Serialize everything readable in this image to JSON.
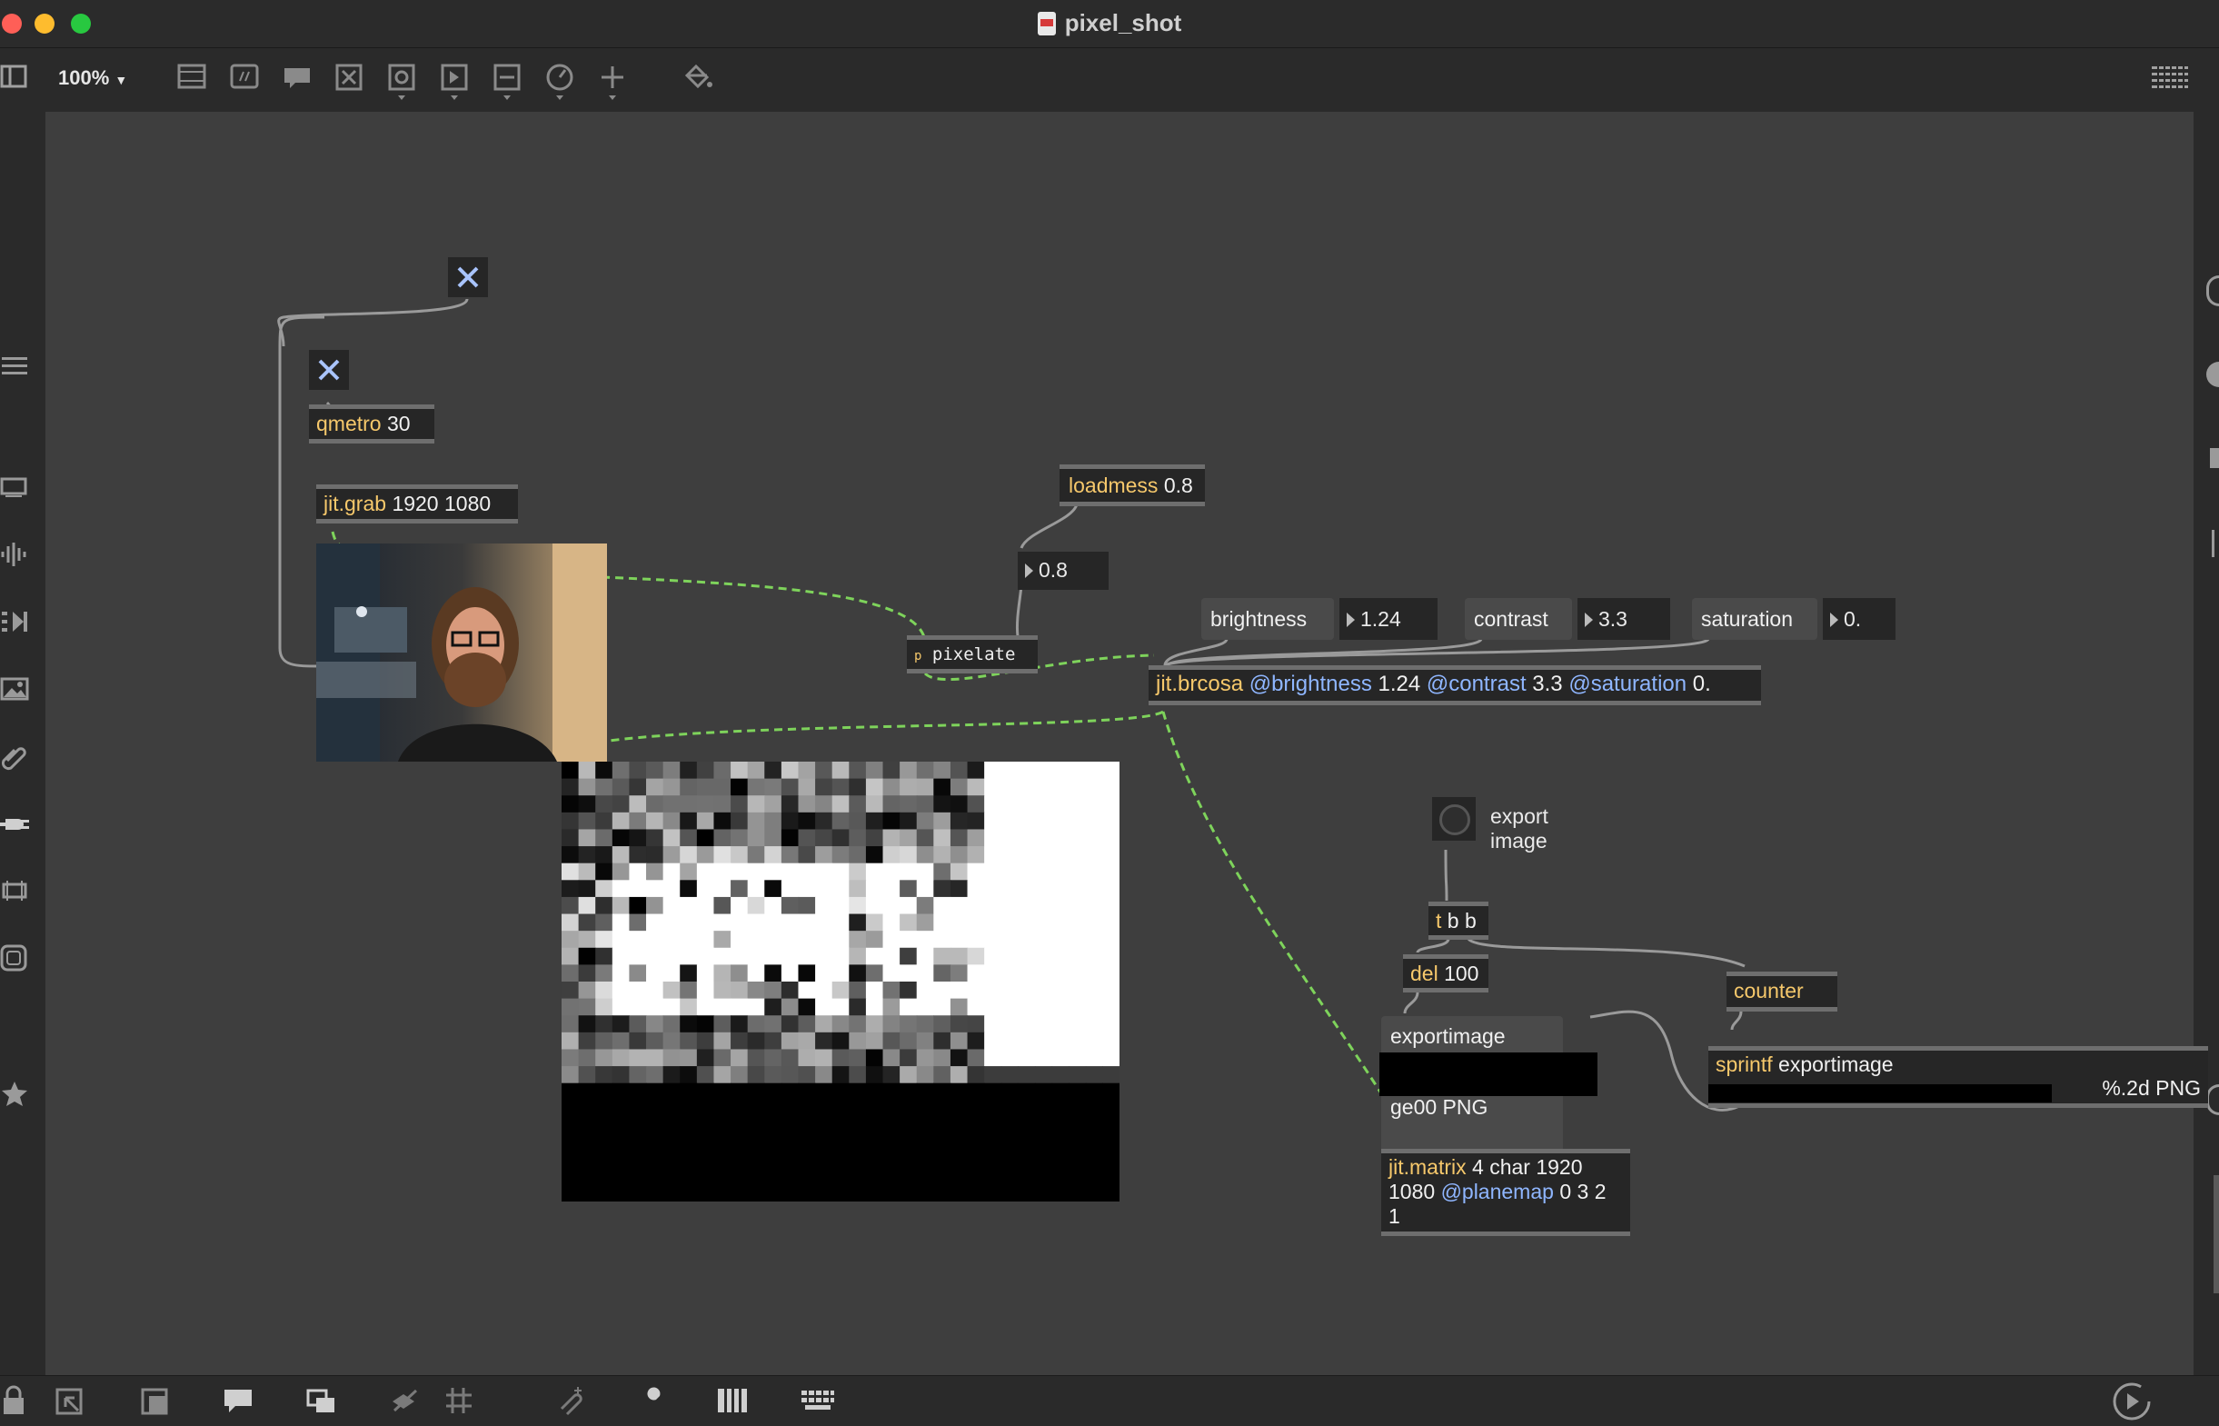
{
  "window": {
    "title": "pixel_shot"
  },
  "toolbar": {
    "zoom": "100%",
    "zoom_arrow": "▼"
  },
  "objects": {
    "qmetro": {
      "cls": "qmetro",
      "args": "30"
    },
    "jitgrab": {
      "cls": "jit.grab",
      "args": "1920 1080"
    },
    "loadmess": {
      "cls": "loadmess",
      "args": "0.8"
    },
    "num_pixel": "0.8",
    "pixelate": {
      "p": "p",
      "name": "pixelate"
    },
    "brightness_msg": "brightness",
    "brightness_val": "1.24",
    "contrast_msg": "contrast",
    "contrast_val": "3.3",
    "saturation_msg": "saturation",
    "saturation_val": "0.",
    "brcosa": {
      "cls": "jit.brcosa",
      "a1": "@brightness",
      "v1": "1.24",
      "a2": "@contrast",
      "v2": "3.3",
      "a3": "@saturation",
      "v3": "0."
    },
    "export_comment_1": "export",
    "export_comment_2": "image",
    "tbb": {
      "cls": "t",
      "args": "b b"
    },
    "del": {
      "cls": "del",
      "args": "100"
    },
    "counter": {
      "cls": "counter"
    },
    "exportimage_msg_top": "exportimage",
    "exportimage_msg_bottom": "ge00 PNG",
    "sprintf": {
      "cls": "sprintf",
      "line1": "exportimage",
      "line2_end": "%.2d PNG"
    },
    "jitmatrix": {
      "cls": "jit.matrix",
      "args1": "4 char 1920",
      "args2a": "1080",
      "attr": "@planemap",
      "args2b": "0 3 2",
      "args3": "1"
    }
  },
  "colors": {
    "canvas": "#3e3e3e",
    "object_bg": "#262626",
    "class_text": "#f6c86b",
    "attr_text": "#8fb6ff",
    "jitter_wire": "#7ed35b",
    "wire": "#9a9a9a",
    "toggle_x": "#a9c4ff"
  },
  "icons": {
    "left": [
      "sidebar-toggle-icon",
      "list-icon",
      "presentation-icon",
      "waveform-icon",
      "sequence-icon",
      "image-icon",
      "paperclip-icon",
      "plug-icon",
      "device-icon",
      "frame-icon",
      "star-icon"
    ],
    "bottom": [
      "lock-icon",
      "edit-icon",
      "patcher-icon",
      "comment-icon",
      "layers-icon",
      "hide-icon",
      "grid-icon",
      "snap-icon",
      "wrench-icon",
      "piano-icon",
      "keyboard-icon",
      "play-icon"
    ]
  }
}
